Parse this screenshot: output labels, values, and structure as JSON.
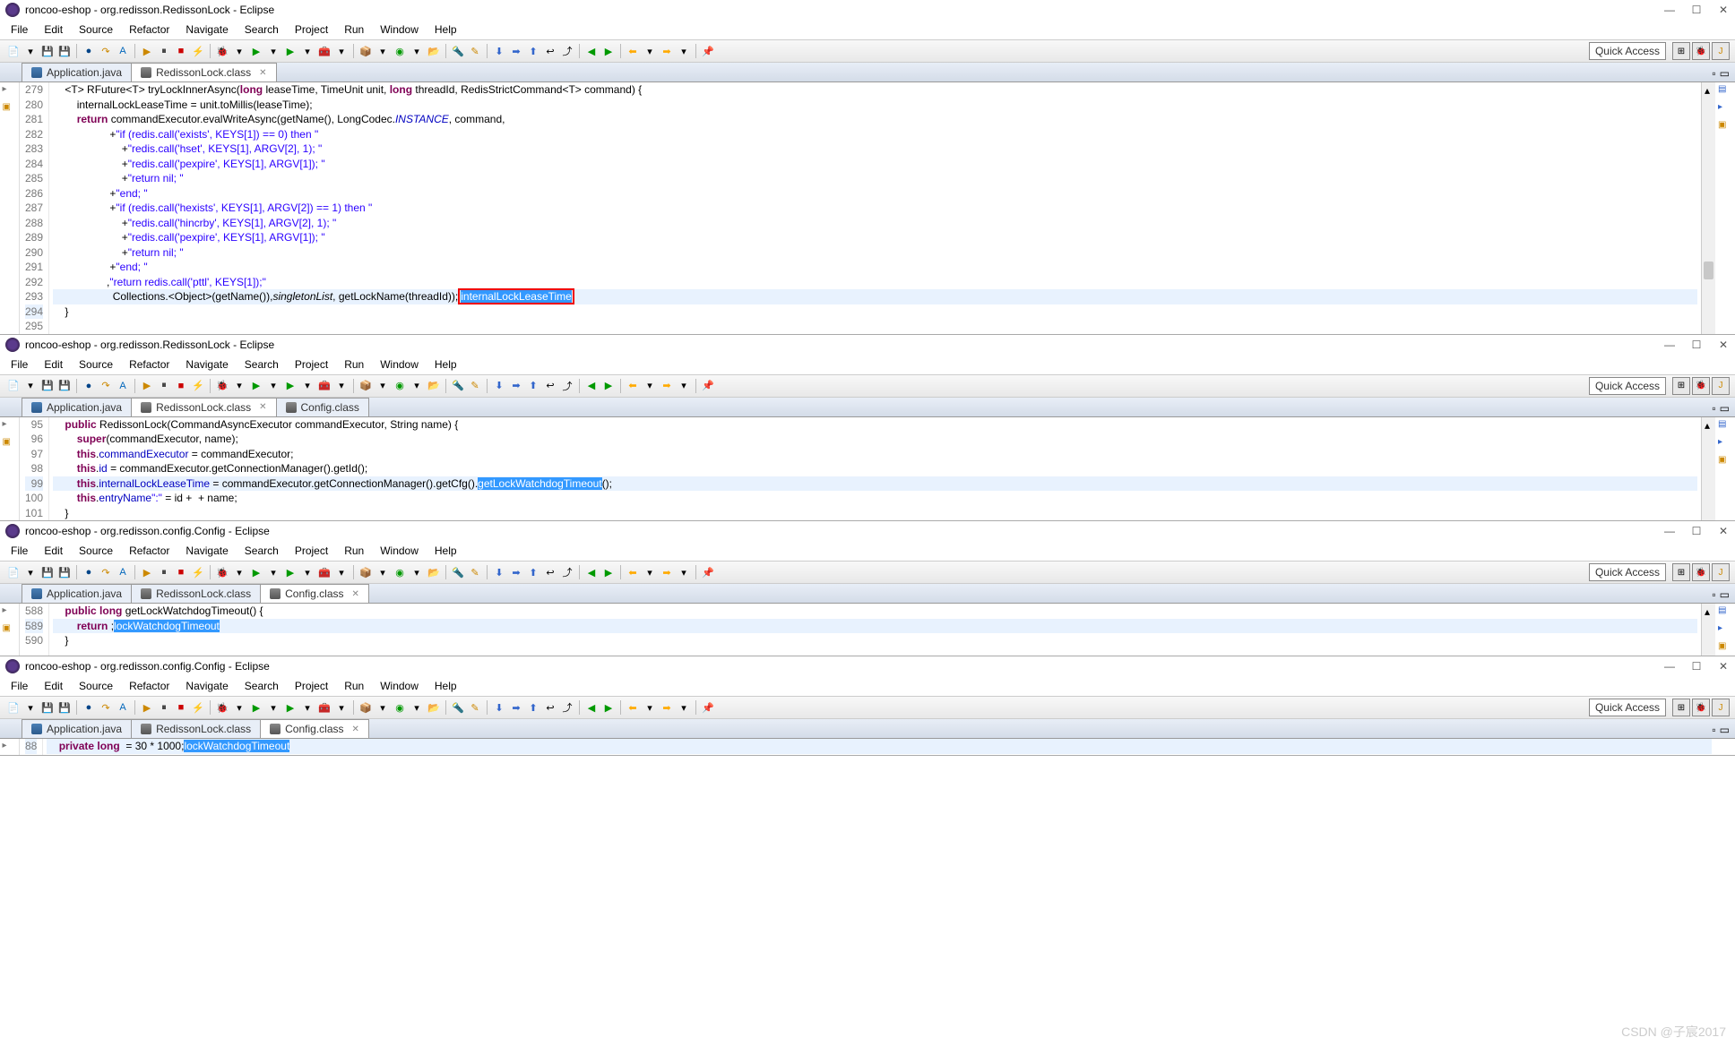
{
  "windows": [
    {
      "title": "roncoo-eshop - org.redisson.RedissonLock - Eclipse"
    },
    {
      "title": "roncoo-eshop - org.redisson.RedissonLock - Eclipse"
    },
    {
      "title": "roncoo-eshop - org.redisson.config.Config - Eclipse"
    },
    {
      "title": "roncoo-eshop - org.redisson.config.Config - Eclipse"
    }
  ],
  "menu": [
    "File",
    "Edit",
    "Source",
    "Refactor",
    "Navigate",
    "Search",
    "Project",
    "Run",
    "Window",
    "Help"
  ],
  "quickAccess": "Quick Access",
  "tabs1": [
    {
      "label": "Application.java",
      "active": false
    },
    {
      "label": "RedissonLock.class",
      "active": true
    }
  ],
  "tabs2": [
    {
      "label": "Application.java",
      "active": false
    },
    {
      "label": "RedissonLock.class",
      "active": true
    },
    {
      "label": "Config.class",
      "active": false
    }
  ],
  "tabs3": [
    {
      "label": "Application.java",
      "active": false
    },
    {
      "label": "RedissonLock.class",
      "active": false
    },
    {
      "label": "Config.class",
      "active": true
    }
  ],
  "code1": {
    "start": 279,
    "current": 294,
    "lines": [
      {
        "t": "    <T> RFuture<T> tryLockInnerAsync(",
        "k": "long",
        "t2": " leaseTime, TimeUnit unit, ",
        "k2": "long",
        "t3": " threadId, RedisStrictCommand<T> command) {"
      },
      {
        "t": "        internalLockLeaseTime = unit.toMillis(leaseTime);"
      },
      {
        "t": ""
      },
      {
        "t": "        ",
        "k": "return",
        "t2": " commandExecutor.evalWriteAsync(getName(), LongCodec.",
        "c": "INSTANCE",
        "t3": ", command,"
      },
      {
        "t": "                  ",
        "s": "\"if (redis.call('exists', KEYS[1]) == 0) then \"",
        "t2": " +"
      },
      {
        "t": "                      ",
        "s": "\"redis.call('hset', KEYS[1], ARGV[2], 1); \"",
        "t2": " +"
      },
      {
        "t": "                      ",
        "s": "\"redis.call('pexpire', KEYS[1], ARGV[1]); \"",
        "t2": " +"
      },
      {
        "t": "                      ",
        "s": "\"return nil; \"",
        "t2": " +"
      },
      {
        "t": "                  ",
        "s": "\"end; \"",
        "t2": " +"
      },
      {
        "t": "                  ",
        "s": "\"if (redis.call('hexists', KEYS[1], ARGV[2]) == 1) then \"",
        "t2": " +"
      },
      {
        "t": "                      ",
        "s": "\"redis.call('hincrby', KEYS[1], ARGV[2], 1); \"",
        "t2": " +"
      },
      {
        "t": "                      ",
        "s": "\"redis.call('pexpire', KEYS[1], ARGV[1]); \"",
        "t2": " +"
      },
      {
        "t": "                      ",
        "s": "\"return nil; \"",
        "t2": " +"
      },
      {
        "t": "                  ",
        "s": "\"end; \"",
        "t2": " +"
      },
      {
        "t": "                  ",
        "s": "\"return redis.call('pttl', KEYS[1]);\"",
        "t2": ","
      },
      {
        "t": "                    Collections.<Object>",
        "i": "singletonList",
        "t2": "(getName()),",
        "box": "internalLockLeaseTime",
        "t3": ", getLockName(threadId));"
      },
      {
        "t": "    }"
      }
    ]
  },
  "code2": {
    "start": 95,
    "current": 99,
    "lines": [
      {
        "t": "    ",
        "k": "public",
        "t2": " RedissonLock(CommandAsyncExecutor commandExecutor, String name) {"
      },
      {
        "t": "        ",
        "k": "super",
        "t2": "(commandExecutor, name);"
      },
      {
        "t": "        ",
        "k": "this",
        "t2": ".",
        "f": "commandExecutor",
        "t3": " = commandExecutor;"
      },
      {
        "t": "        ",
        "k": "this",
        "t2": ".",
        "f": "id",
        "t3": " = commandExecutor.getConnectionManager().getId();"
      },
      {
        "t": "        ",
        "k": "this",
        "t2": ".",
        "f": "internalLockLeaseTime",
        "t3": " = commandExecutor.getConnectionManager().getCfg().",
        "sel": "getLockWatchdogTimeout",
        "t4": "();"
      },
      {
        "t": "        ",
        "k": "this",
        "t2": ".",
        "f": "entryName",
        "t3": " = id + ",
        "s": "\":\"",
        "t4": " + name;"
      },
      {
        "t": "    }"
      }
    ]
  },
  "code3": {
    "start": 588,
    "current": 589,
    "lines": [
      {
        "t": "    ",
        "k": "public long",
        "t2": " getLockWatchdogTimeout() {"
      },
      {
        "t": "        ",
        "k": "return",
        "t2": " ",
        "sel": "lockWatchdogTimeout",
        "t3": ";"
      },
      {
        "t": "    }"
      }
    ]
  },
  "code4": {
    "start": 88,
    "current": 88,
    "lines": [
      {
        "t": "    ",
        "k": "private long",
        "t2": " ",
        "sel": "lockWatchdogTimeout",
        "t3": " = 30 * 1000;"
      }
    ]
  },
  "watermark": "CSDN @子宸2017"
}
